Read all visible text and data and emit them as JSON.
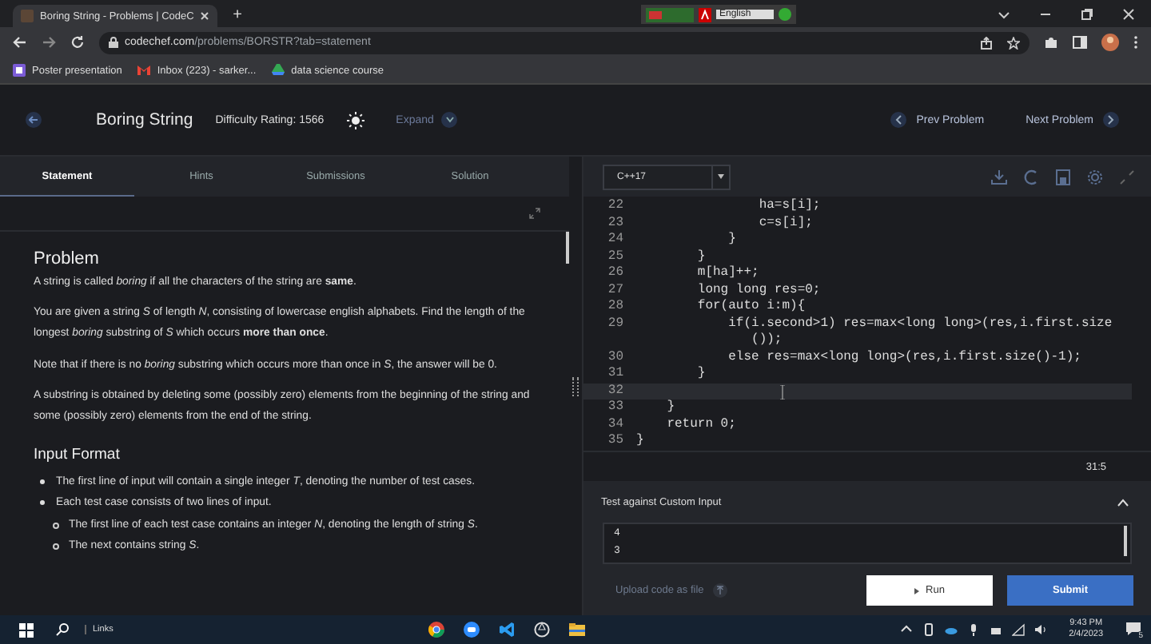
{
  "browser": {
    "tab_title": "Boring String - Problems | CodeC",
    "new_tab": "+",
    "url_host": "codechef.com",
    "url_path": "/problems/BORSTR?tab=statement",
    "ime_language": "English",
    "bookmarks": [
      {
        "label": "Poster presentation"
      },
      {
        "label": "Inbox (223) - sarker..."
      },
      {
        "label": "data science course"
      }
    ]
  },
  "header": {
    "title": "Boring String",
    "difficulty": "Difficulty Rating: 1566",
    "expand": "Expand",
    "prev": "Prev Problem",
    "next": "Next Problem"
  },
  "tabs": [
    {
      "label": "Statement",
      "selected": true
    },
    {
      "label": "Hints",
      "selected": false
    },
    {
      "label": "Submissions",
      "selected": false
    },
    {
      "label": "Solution",
      "selected": false
    }
  ],
  "statement": {
    "sections": [
      {
        "heading": "Problem",
        "paragraphs": [
          "A string is called *boring* if all the characters of the string are **same**.",
          "You are given a string *S* of length *N*, consisting of lowercase english alphabets. Find the length of the longest *boring* substring of *S* which occurs **more than once**.",
          "Note that if there is no *boring* substring which occurs more than once in *S*, the answer will be 0.",
          "A substring is obtained by deleting some (possibly zero) elements from the beginning of the string and some (possibly zero) elements from the end of the string."
        ]
      },
      {
        "heading": "Input Format",
        "bullets": [
          {
            "text": "The first line of input will contain a single integer *T*, denoting the number of test cases."
          },
          {
            "text": "Each test case consists of two lines of input.",
            "children": [
              {
                "text": "The first line of each test case contains an integer *N*, denoting the length of string *S*."
              },
              {
                "text": "The next contains string *S*."
              }
            ]
          }
        ]
      }
    ]
  },
  "editor": {
    "language": "C++17",
    "lines": [
      {
        "number": "22",
        "text": "                ha=s[i];",
        "current": false
      },
      {
        "number": "23",
        "text": "                c=s[i];",
        "current": false
      },
      {
        "number": "24",
        "text": "            }",
        "current": false
      },
      {
        "number": "25",
        "text": "        }",
        "current": false
      },
      {
        "number": "26",
        "text": "        m[ha]++;",
        "current": false
      },
      {
        "number": "27",
        "text": "        long long res=0;",
        "current": false
      },
      {
        "number": "28",
        "text": "        for(auto i:m){",
        "current": false
      },
      {
        "number": "29",
        "text": "            if(i.second>1) res=max<long long>(res,i.first.size",
        "current": false
      },
      {
        "text": "               ());",
        "current": false
      },
      {
        "number": "30",
        "text": "            else res=max<long long>(res,i.first.size()-1);",
        "current": false
      },
      {
        "number": "31",
        "text": "        }",
        "current": false
      },
      {
        "number": "32",
        "current": true
      },
      {
        "number": "33",
        "text": "    }",
        "current": false
      },
      {
        "number": "34",
        "text": "    return 0;",
        "current": false
      },
      {
        "number": "35",
        "text": "}",
        "current": false
      }
    ],
    "cursor_position": "31:5"
  },
  "custom_input": {
    "title": "Test against Custom Input",
    "lines": [
      "4",
      "3"
    ]
  },
  "actions": {
    "upload": "Upload code as file",
    "run": "Run",
    "submit": "Submit"
  },
  "taskbar": {
    "search": "Links",
    "time": "9:43 PM",
    "date": "2/4/2023",
    "notifications": "5"
  }
}
